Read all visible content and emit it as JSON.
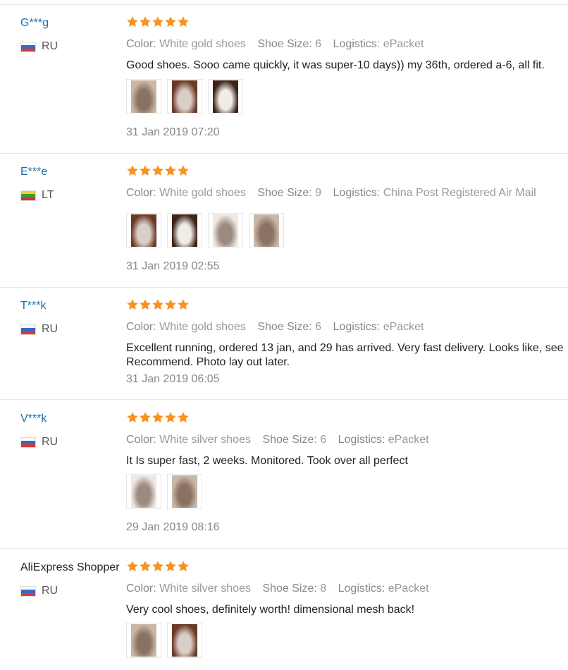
{
  "reviews": [
    {
      "user": "G***g",
      "country": "RU",
      "flag": "ru",
      "stars": 5,
      "color_label": "Color:",
      "color": "White gold shoes",
      "size_label": "Shoe Size:",
      "size": "6",
      "logistics_label": "Logistics:",
      "logistics": "ePacket",
      "text": "Good shoes. Sooo came quickly, it was super-10 days)) my 36th, ordered a-6, all fit.",
      "text2": "",
      "photos": 3,
      "date": "31 Jan 2019 07:20"
    },
    {
      "user": "E***e",
      "country": "LT",
      "flag": "lt",
      "stars": 5,
      "color_label": "Color:",
      "color": "White gold shoes",
      "size_label": "Shoe Size:",
      "size": "9",
      "logistics_label": "Logistics:",
      "logistics": "China Post Registered Air Mail",
      "text": "",
      "text2": "",
      "photos": 4,
      "date": "31 Jan 2019 02:55"
    },
    {
      "user": "T***k",
      "country": "RU",
      "flag": "ru",
      "stars": 5,
      "color_label": "Color:",
      "color": "White gold shoes",
      "size_label": "Shoe Size:",
      "size": "6",
      "logistics_label": "Logistics:",
      "logistics": "ePacket",
      "text": "Excellent running, ordered 13 jan, and 29 has arrived. Very fast delivery. Looks like, see",
      "text2": "Recommend. Photo lay out later.",
      "photos": 0,
      "date": "31 Jan 2019 06:05"
    },
    {
      "user": "V***k",
      "country": "RU",
      "flag": "ru",
      "stars": 5,
      "color_label": "Color:",
      "color": "White silver shoes",
      "size_label": "Shoe Size:",
      "size": "6",
      "logistics_label": "Logistics:",
      "logistics": "ePacket",
      "text": "It Is super fast, 2 weeks. Monitored. Took over all perfect",
      "text2": "",
      "photos": 2,
      "date": "29 Jan 2019 08:16"
    },
    {
      "user": "AliExpress Shopper",
      "country": "RU",
      "flag": "ru",
      "stars": 5,
      "color_label": "Color:",
      "color": "White silver shoes",
      "size_label": "Shoe Size:",
      "size": "8",
      "logistics_label": "Logistics:",
      "logistics": "ePacket",
      "text": "Very cool shoes, definitely worth! dimensional mesh back!",
      "text2": "",
      "photos": 2,
      "date": ""
    }
  ],
  "colors": {
    "star": "#f7931e",
    "username": "#1a6ea8"
  }
}
